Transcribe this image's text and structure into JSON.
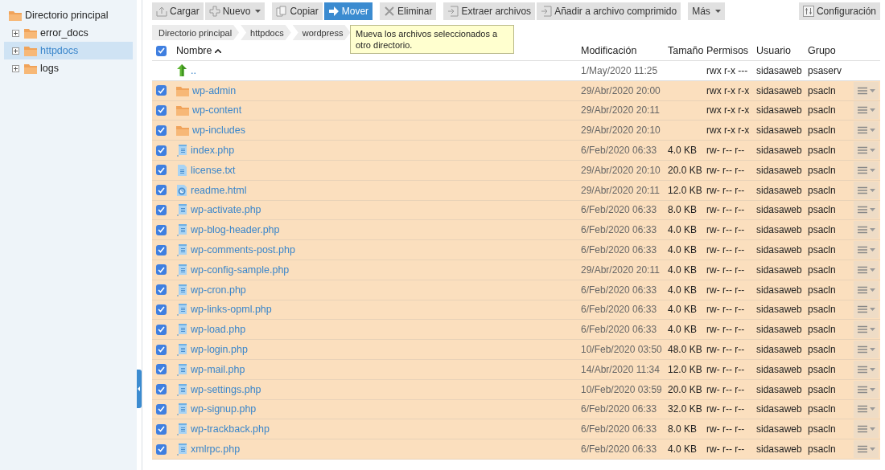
{
  "sidebar": {
    "tree": [
      {
        "label": "Directorio principal",
        "selected": false,
        "children": [
          {
            "label": "error_docs",
            "expanded": false,
            "selected": false
          },
          {
            "label": "httpdocs",
            "expanded": false,
            "selected": true
          },
          {
            "label": "logs",
            "expanded": false,
            "selected": false
          }
        ]
      }
    ]
  },
  "toolbar": {
    "groups": [
      [
        {
          "label": "Cargar",
          "active": false,
          "dropdown": false
        },
        {
          "label": "Nuevo",
          "active": false,
          "dropdown": true
        }
      ],
      [
        {
          "label": "Copiar",
          "active": false,
          "dropdown": false
        },
        {
          "label": "Mover",
          "active": true,
          "dropdown": false
        }
      ],
      [
        {
          "label": "Eliminar",
          "active": false,
          "dropdown": false
        }
      ],
      [
        {
          "label": "Extraer archivos",
          "active": false,
          "dropdown": false
        },
        {
          "label": "Añadir a archivo comprimido",
          "active": false,
          "dropdown": false
        }
      ],
      [
        {
          "label": "Más",
          "active": false,
          "dropdown": true
        }
      ]
    ],
    "settings": {
      "label": "Configuración"
    }
  },
  "breadcrumb": [
    "Directorio principal",
    "httpdocs",
    "wordpress"
  ],
  "tooltip": "Mueva los archivos seleccionados a otro directorio.",
  "table": {
    "select_all": {
      "checked": true
    },
    "columns": [
      {
        "label": "Nombre",
        "sorted": true
      },
      {
        "label": "Modificación",
        "sorted": false
      },
      {
        "label": "Tamaño",
        "sorted": false
      },
      {
        "label": "Permisos",
        "sorted": false
      },
      {
        "label": "Usuario",
        "sorted": false
      },
      {
        "label": "Grupo",
        "sorted": false
      }
    ],
    "parent_row": {
      "name": "..",
      "modified": "1/May/2020 11:25",
      "permissions": "rwx r-x ---",
      "user": "sidasaweb",
      "group": "psaserv"
    },
    "rows": [
      {
        "kind": "folder",
        "name": "wp-admin",
        "modified": "29/Abr/2020 20:00",
        "permissions": "rwx r-x r-x",
        "user": "sidasaweb",
        "group": "psacln",
        "selected": true
      },
      {
        "kind": "folder",
        "name": "wp-content",
        "modified": "29/Abr/2020 20:11",
        "permissions": "rwx r-x r-x",
        "user": "sidasaweb",
        "group": "psacln",
        "selected": true
      },
      {
        "kind": "folder",
        "name": "wp-includes",
        "modified": "29/Abr/2020 20:10",
        "permissions": "rwx r-x r-x",
        "user": "sidasaweb",
        "group": "psacln",
        "selected": true
      },
      {
        "kind": "script",
        "name": "index.php",
        "modified": "6/Feb/2020 06:33",
        "size": "4.0 KB",
        "permissions": "rw- r-- r--",
        "user": "sidasaweb",
        "group": "psacln",
        "selected": true
      },
      {
        "kind": "text",
        "name": "license.txt",
        "modified": "29/Abr/2020 20:10",
        "size": "20.0 KB",
        "permissions": "rw- r-- r--",
        "user": "sidasaweb",
        "group": "psacln",
        "selected": true
      },
      {
        "kind": "web",
        "name": "readme.html",
        "modified": "29/Abr/2020 20:11",
        "size": "12.0 KB",
        "permissions": "rw- r-- r--",
        "user": "sidasaweb",
        "group": "psacln",
        "selected": true
      },
      {
        "kind": "script",
        "name": "wp-activate.php",
        "modified": "6/Feb/2020 06:33",
        "size": "8.0 KB",
        "permissions": "rw- r-- r--",
        "user": "sidasaweb",
        "group": "psacln",
        "selected": true
      },
      {
        "kind": "script",
        "name": "wp-blog-header.php",
        "modified": "6/Feb/2020 06:33",
        "size": "4.0 KB",
        "permissions": "rw- r-- r--",
        "user": "sidasaweb",
        "group": "psacln",
        "selected": true
      },
      {
        "kind": "script",
        "name": "wp-comments-post.php",
        "modified": "6/Feb/2020 06:33",
        "size": "4.0 KB",
        "permissions": "rw- r-- r--",
        "user": "sidasaweb",
        "group": "psacln",
        "selected": true
      },
      {
        "kind": "script",
        "name": "wp-config-sample.php",
        "modified": "29/Abr/2020 20:11",
        "size": "4.0 KB",
        "permissions": "rw- r-- r--",
        "user": "sidasaweb",
        "group": "psacln",
        "selected": true
      },
      {
        "kind": "script",
        "name": "wp-cron.php",
        "modified": "6/Feb/2020 06:33",
        "size": "4.0 KB",
        "permissions": "rw- r-- r--",
        "user": "sidasaweb",
        "group": "psacln",
        "selected": true
      },
      {
        "kind": "script",
        "name": "wp-links-opml.php",
        "modified": "6/Feb/2020 06:33",
        "size": "4.0 KB",
        "permissions": "rw- r-- r--",
        "user": "sidasaweb",
        "group": "psacln",
        "selected": true
      },
      {
        "kind": "script",
        "name": "wp-load.php",
        "modified": "6/Feb/2020 06:33",
        "size": "4.0 KB",
        "permissions": "rw- r-- r--",
        "user": "sidasaweb",
        "group": "psacln",
        "selected": true
      },
      {
        "kind": "script",
        "name": "wp-login.php",
        "modified": "10/Feb/2020 03:50",
        "size": "48.0 KB",
        "permissions": "rw- r-- r--",
        "user": "sidasaweb",
        "group": "psacln",
        "selected": true
      },
      {
        "kind": "script",
        "name": "wp-mail.php",
        "modified": "14/Abr/2020 11:34",
        "size": "12.0 KB",
        "permissions": "rw- r-- r--",
        "user": "sidasaweb",
        "group": "psacln",
        "selected": true
      },
      {
        "kind": "script",
        "name": "wp-settings.php",
        "modified": "10/Feb/2020 03:59",
        "size": "20.0 KB",
        "permissions": "rw- r-- r--",
        "user": "sidasaweb",
        "group": "psacln",
        "selected": true
      },
      {
        "kind": "script",
        "name": "wp-signup.php",
        "modified": "6/Feb/2020 06:33",
        "size": "32.0 KB",
        "permissions": "rw- r-- r--",
        "user": "sidasaweb",
        "group": "psacln",
        "selected": true
      },
      {
        "kind": "script",
        "name": "wp-trackback.php",
        "modified": "6/Feb/2020 06:33",
        "size": "8.0 KB",
        "permissions": "rw- r-- r--",
        "user": "sidasaweb",
        "group": "psacln",
        "selected": true
      },
      {
        "kind": "script",
        "name": "xmlrpc.php",
        "modified": "6/Feb/2020 06:33",
        "size": "4.0 KB",
        "permissions": "rw- r-- r--",
        "user": "sidasaweb",
        "group": "psacln",
        "selected": true
      }
    ]
  }
}
